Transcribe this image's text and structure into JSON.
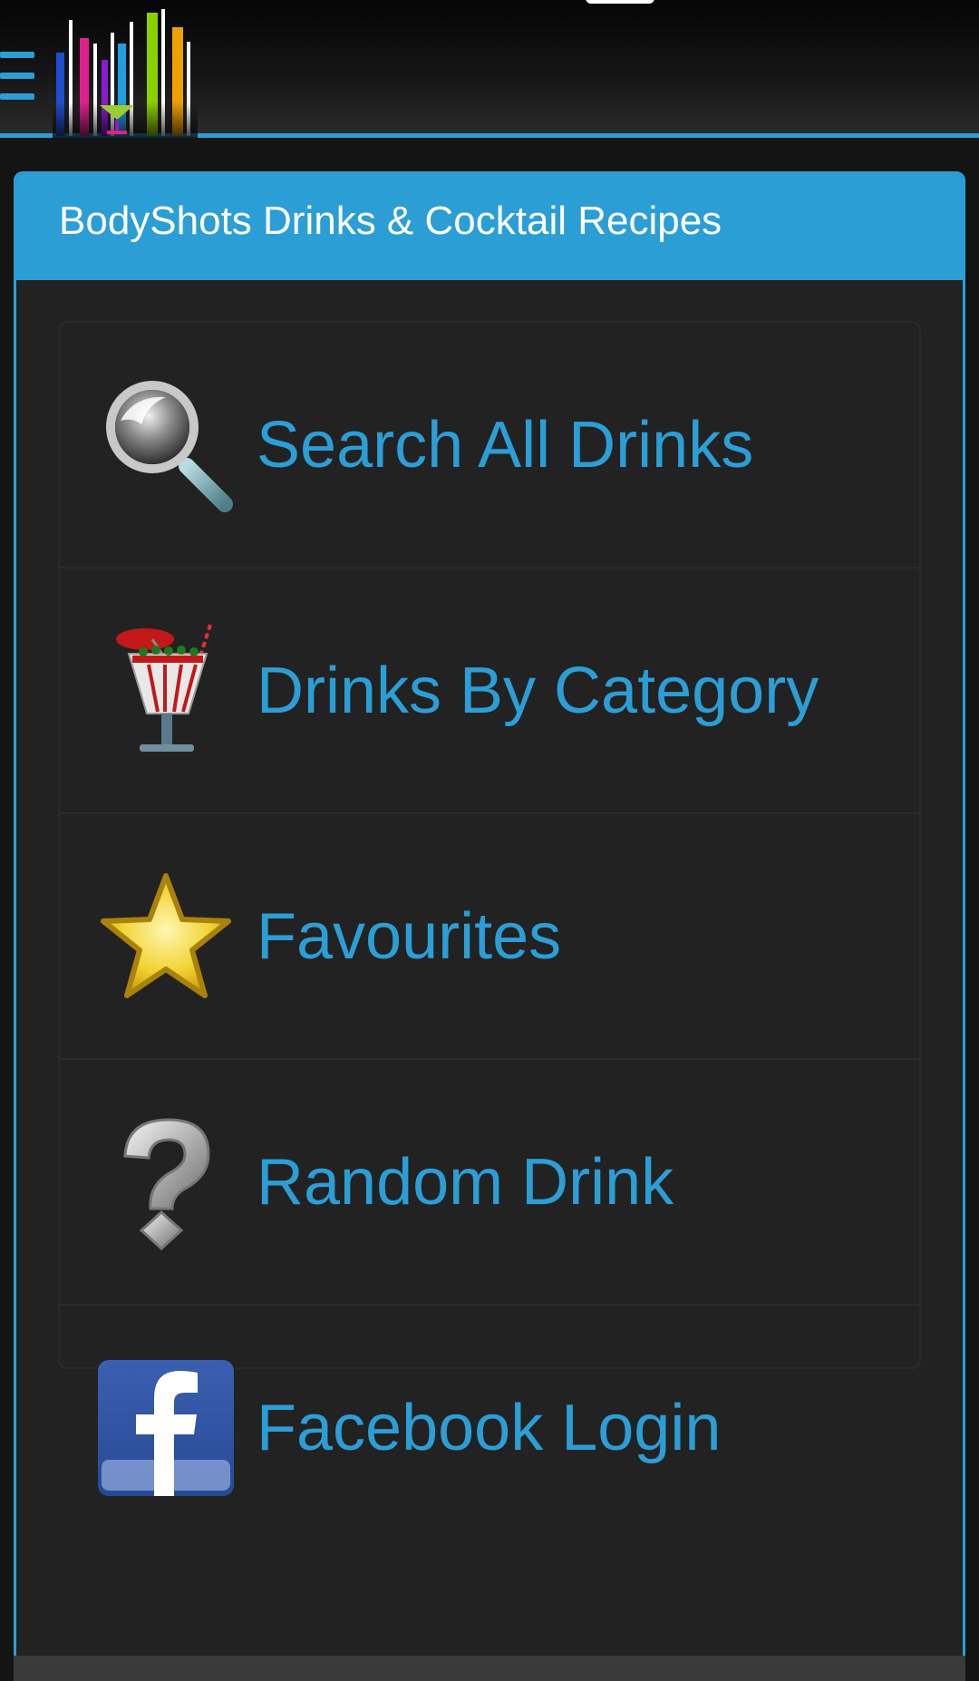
{
  "header": {
    "menu_icon": "hamburger-menu-icon",
    "logo_icon": "bodyshots-equalizer-cocktail-logo",
    "accent_color": "#2c9ed6"
  },
  "panel": {
    "title": "BodyShots Drinks & Cocktail Recipes"
  },
  "menu": {
    "items": [
      {
        "label": "Search All Drinks",
        "icon": "magnifying-glass-icon"
      },
      {
        "label": "Drinks By Category",
        "icon": "cocktail-glass-icon"
      },
      {
        "label": "Favourites",
        "icon": "star-icon"
      },
      {
        "label": "Random Drink",
        "icon": "question-mark-icon"
      },
      {
        "label": "Facebook Login",
        "icon": "facebook-icon"
      }
    ]
  }
}
